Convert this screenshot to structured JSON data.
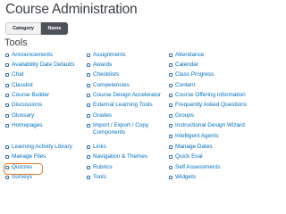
{
  "page": {
    "title": "Course Administration"
  },
  "sort_toggle": {
    "category_label": "Category",
    "name_label": "Name",
    "selected": "Name"
  },
  "section": {
    "title": "Tools"
  },
  "columns": [
    [
      {
        "label": "Announcements",
        "icon": "megaphone-icon"
      },
      {
        "label": "Availability Date Defaults",
        "icon": "calendar-clock-icon"
      },
      {
        "label": "Chat",
        "icon": "chat-bubble-icon"
      },
      {
        "label": "Classlist",
        "icon": "people-icon"
      },
      {
        "label": "Course Builder",
        "icon": "building-blocks-icon"
      },
      {
        "label": "Discussions",
        "icon": "discussion-icon"
      },
      {
        "label": "Glossary",
        "icon": "book-icon"
      },
      {
        "label": "Homepages",
        "icon": "home-icon"
      },
      {
        "label": "Learning Activity Library",
        "icon": "library-icon"
      },
      {
        "label": "Manage Files",
        "icon": "folder-icon"
      },
      {
        "label": "Quizzes",
        "icon": "quiz-icon"
      },
      {
        "label": "Surveys",
        "icon": "survey-icon"
      }
    ],
    [
      {
        "label": "Assignments",
        "icon": "assignment-icon"
      },
      {
        "label": "Awards",
        "icon": "award-icon"
      },
      {
        "label": "Checklists",
        "icon": "checklist-icon"
      },
      {
        "label": "Competencies",
        "icon": "competency-icon"
      },
      {
        "label": "Course Design Accelerator",
        "icon": "accelerator-icon"
      },
      {
        "label": "External Learning Tools",
        "icon": "external-tool-icon"
      },
      {
        "label": "Grades",
        "icon": "grades-icon"
      },
      {
        "label": "Import / Export / Copy Components",
        "icon": "import-export-icon"
      },
      {
        "label": "Links",
        "icon": "link-icon"
      },
      {
        "label": "Navigation & Themes",
        "icon": "navigation-icon"
      },
      {
        "label": "Rubrics",
        "icon": "rubric-icon"
      },
      {
        "label": "Tools",
        "icon": "wrench-icon"
      }
    ],
    [
      {
        "label": "Attendance",
        "icon": "attendance-icon"
      },
      {
        "label": "Calendar",
        "icon": "calendar-icon"
      },
      {
        "label": "Class Progress",
        "icon": "progress-icon"
      },
      {
        "label": "Content",
        "icon": "content-icon"
      },
      {
        "label": "Course Offering Information",
        "icon": "info-icon"
      },
      {
        "label": "Frequently Asked Questions",
        "icon": "faq-icon"
      },
      {
        "label": "Groups",
        "icon": "groups-icon"
      },
      {
        "label": "Instructional Design Wizard",
        "icon": "wizard-icon"
      },
      {
        "label": "Intelligent Agents",
        "icon": "agent-icon"
      },
      {
        "label": "Manage Dates",
        "icon": "dates-icon"
      },
      {
        "label": "Quick Eval",
        "icon": "quick-eval-icon"
      },
      {
        "label": "Self Assessments",
        "icon": "self-assessment-icon"
      },
      {
        "label": "Widgets",
        "icon": "widget-icon"
      }
    ]
  ],
  "colors": {
    "link": "#006fbf",
    "highlight": "#ec7a26",
    "selected_button": "#4c5258"
  }
}
